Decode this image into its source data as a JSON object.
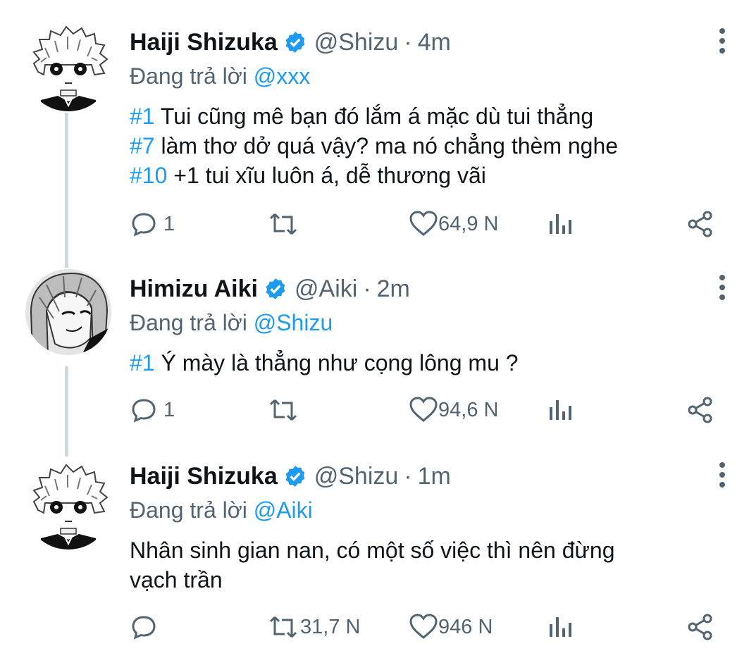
{
  "tweets": [
    {
      "name": "Haiji Shizuka",
      "handle": "@Shizu",
      "separator": "·",
      "time": "4m",
      "reply_prefix": "Đang trả lời",
      "reply_to": "@xxx",
      "lines": [
        {
          "tag": "#1",
          "text": " Tui cũng mê bạn đó lắm á mặc dù tui thẳng"
        },
        {
          "tag": "#7",
          "text": " làm thơ dở quá vậy? ma nó chẳng thèm nghe"
        },
        {
          "tag": "#10",
          "text": " +1 tui xĩu luôn á, dễ thương vãi"
        }
      ],
      "stats": {
        "replies": "1",
        "retweets": "",
        "likes": "64,9 N"
      },
      "avatar": "manga-curly-hair-avatar"
    },
    {
      "name": "Himizu Aiki",
      "handle": "@Aiki",
      "separator": "·",
      "time": "2m",
      "reply_prefix": "Đang trả lời",
      "reply_to": "@Shizu",
      "lines": [
        {
          "tag": "#1",
          "text": " Ý mày là thẳng như cọng lông mu ?"
        }
      ],
      "stats": {
        "replies": "1",
        "retweets": "",
        "likes": "94,6 N"
      },
      "avatar": "manga-smirk-avatar"
    },
    {
      "name": "Haiji Shizuka",
      "handle": "@Shizu",
      "separator": "·",
      "time": "1m",
      "reply_prefix": "Đang trả lời",
      "reply_to": "@Aiki",
      "lines": [
        {
          "tag": "",
          "text": "Nhân sinh gian nan, có một số việc thì nên đừng"
        },
        {
          "tag": "",
          "text": "vạch trần"
        }
      ],
      "stats": {
        "replies": "",
        "retweets": "31,7 N",
        "likes": "946 N"
      },
      "avatar": "manga-curly-hair-avatar"
    }
  ],
  "colors": {
    "accent": "#1d9bf0",
    "muted": "#536471",
    "text": "#0f1419",
    "thread": "#cfd9de"
  }
}
